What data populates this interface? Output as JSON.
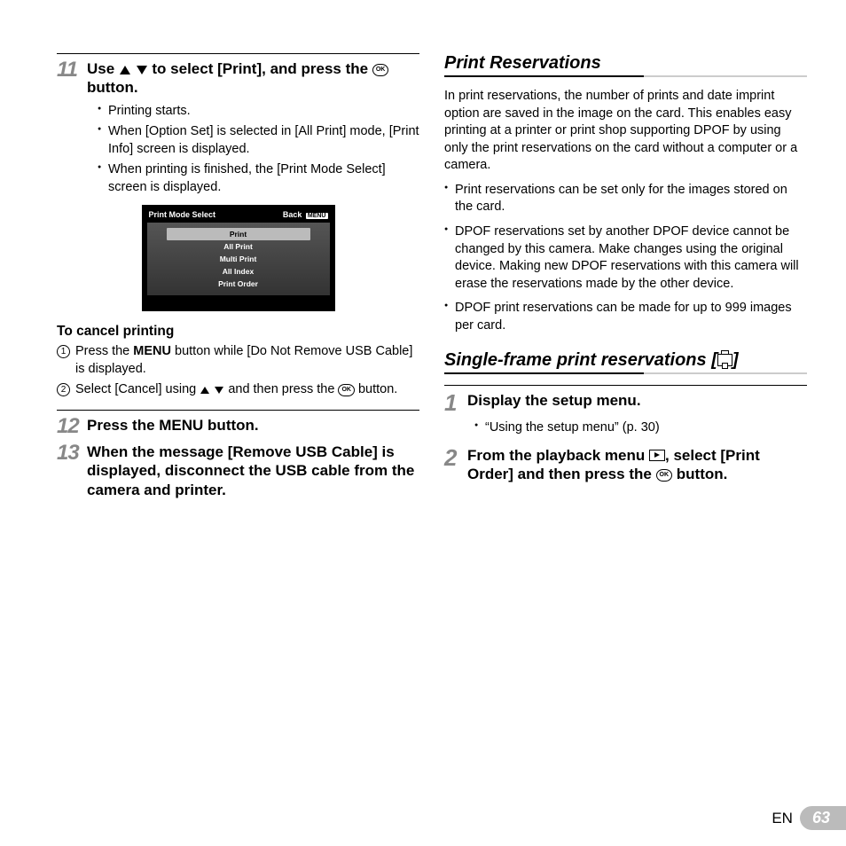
{
  "left": {
    "step11": {
      "num": "11",
      "head_a": "Use ",
      "head_b": " to select [Print], and press the ",
      "head_c": " button.",
      "bullets": [
        "Printing starts.",
        "When [Option Set] is selected in [All Print] mode, [Print Info] screen is displayed.",
        "When printing is finished, the [Print Mode Select] screen is displayed."
      ]
    },
    "screen": {
      "title": "Print Mode Select",
      "back": "Back",
      "menu_badge": "MENU",
      "items": [
        "Print",
        "All Print",
        "Multi Print",
        "All Index",
        "Print Order"
      ],
      "selected_index": 0
    },
    "cancel": {
      "head": "To cancel printing",
      "item1_a": "Press the ",
      "item1_menu": "MENU",
      "item1_b": " button while [Do Not Remove USB Cable] is displayed.",
      "item2_a": "Select [Cancel] using ",
      "item2_b": " and then press the ",
      "item2_c": " button."
    },
    "step12": {
      "num": "12",
      "head_a": "Press the ",
      "menu": "MENU",
      "head_b": " button."
    },
    "step13": {
      "num": "13",
      "head": "When the message [Remove USB Cable] is displayed, disconnect the USB cable from the camera and printer."
    }
  },
  "right": {
    "section1": {
      "title": "Print Reservations",
      "intro": "In print reservations, the number of prints and date imprint option are saved in the image on the card. This enables easy printing at a printer or print shop supporting DPOF by using only the print reservations on the card without a computer or a camera.",
      "bullets": [
        "Print reservations can be set only for the images stored on the card.",
        "DPOF reservations set by another DPOF device cannot be changed by this camera. Make changes using the original device. Making new DPOF reservations with this camera will erase the reservations made by the other device.",
        "DPOF print reservations can be made for up to 999 images per card."
      ]
    },
    "section2": {
      "title_a": "Single-frame print reservations [",
      "title_b": "]",
      "step1": {
        "num": "1",
        "head": "Display the setup menu.",
        "bullet": "“Using the setup menu” (p. 30)"
      },
      "step2": {
        "num": "2",
        "head_a": "From the playback menu ",
        "head_b": ", select [Print Order] and then press the ",
        "head_c": " button."
      }
    }
  },
  "footer": {
    "lang": "EN",
    "page": "63"
  },
  "ok_label": "OK"
}
